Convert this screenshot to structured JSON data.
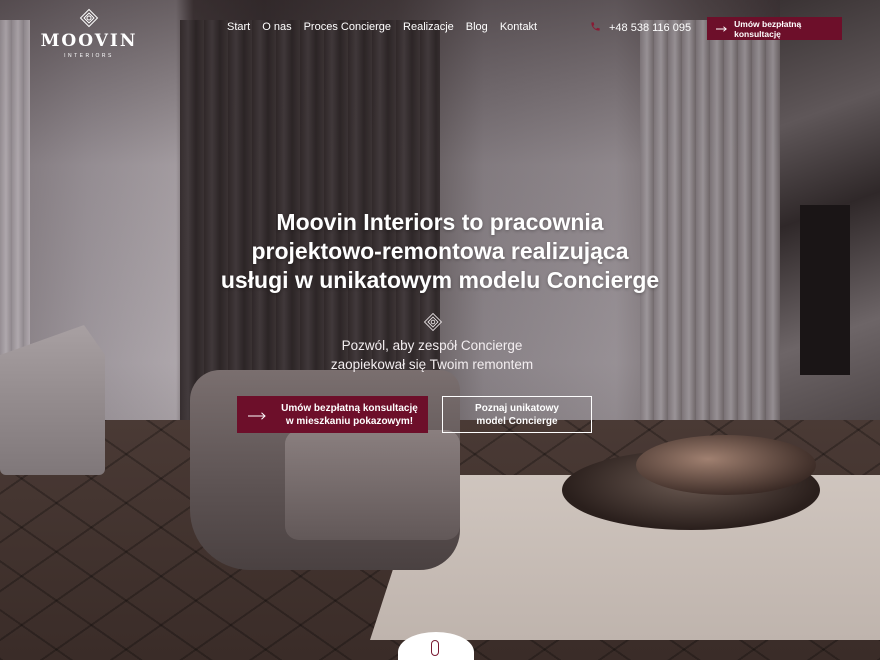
{
  "brand": {
    "name": "MOOVIN",
    "subtitle": "INTERIORS"
  },
  "nav": {
    "items": [
      "Start",
      "O nas",
      "Proces Concierge",
      "Realizacje",
      "Blog",
      "Kontakt"
    ]
  },
  "contact": {
    "phone": "+48 538 116 095"
  },
  "header_cta": {
    "label": "Umów bezpłatną konsultację"
  },
  "hero": {
    "headline_lines": [
      "Moovin Interiors to pracownia",
      "projektowo-remontowa realizująca",
      "usługi w unikatowym modelu Concierge"
    ],
    "subline_lines": [
      "Pozwól, aby zespół Concierge",
      "zaopiekował się Twoim remontem"
    ],
    "primary_button_lines": [
      "Umów bezpłatną konsultację",
      "w mieszkaniu pokazowym!"
    ],
    "secondary_button_lines": [
      "Poznaj unikatowy",
      "model Concierge"
    ]
  },
  "icons": [
    "logo-diamond-icon",
    "phone-icon",
    "arrow-right-icon",
    "ornament-icon",
    "scroll-mouse-icon"
  ],
  "colors": {
    "accent": "#6d0f2a",
    "text": "#ffffff"
  }
}
